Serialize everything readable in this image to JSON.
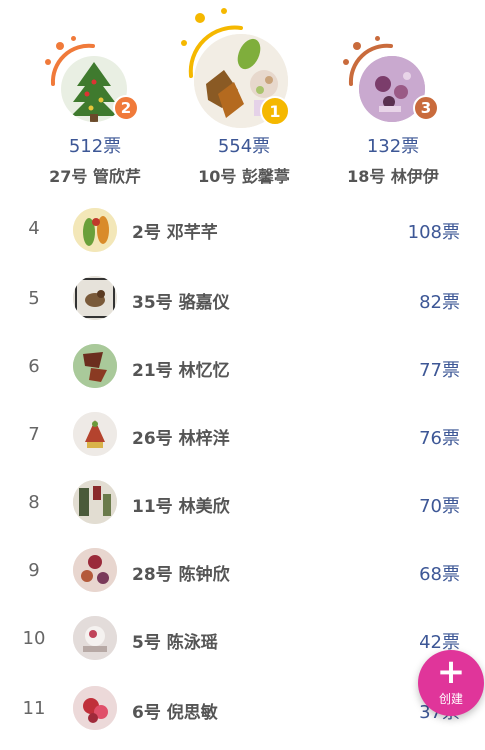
{
  "podium": [
    {
      "rank": "2",
      "votes": "512票",
      "name": "27号 管欣芹",
      "badge_color": "#f07a3a",
      "arc_color": "#f07a3a",
      "avatar_theme": "christmas-tree-art",
      "avatar_bg": "#e9efe3"
    },
    {
      "rank": "1",
      "votes": "554票",
      "name": "10号 彭馨葶",
      "badge_color": "#f5b800",
      "arc_color": "#f5b800",
      "avatar_theme": "leaf-collage-art",
      "avatar_bg": "#f2ede4"
    },
    {
      "rank": "3",
      "votes": "132票",
      "name": "18号 林伊伊",
      "badge_color": "#c96b3c",
      "arc_color": "#c96b3c",
      "avatar_theme": "flower-art-purple",
      "avatar_bg": "#c9a9cf"
    }
  ],
  "list": [
    {
      "rank": "4",
      "name": "2号 邓芊芊",
      "votes": "108票",
      "avatar_color": "#f3e7b8"
    },
    {
      "rank": "5",
      "name": "35号 骆嘉仪",
      "votes": "82票",
      "avatar_color": "#e6e2da"
    },
    {
      "rank": "6",
      "name": "21号 林忆忆",
      "votes": "77票",
      "avatar_color": "#a9c99a"
    },
    {
      "rank": "7",
      "name": "26号 林梓洋",
      "votes": "76票",
      "avatar_color": "#eeeae6"
    },
    {
      "rank": "8",
      "name": "11号 林美欣",
      "votes": "70票",
      "avatar_color": "#e2ddd2"
    },
    {
      "rank": "9",
      "name": "28号 陈钟欣",
      "votes": "68票",
      "avatar_color": "#e8d6cf"
    },
    {
      "rank": "10",
      "name": "5号 陈泳瑶",
      "votes": "42票",
      "avatar_color": "#e3dcda"
    },
    {
      "rank": "11",
      "name": "6号 倪思敏",
      "votes": "37票",
      "avatar_color": "#ecd9d9"
    }
  ],
  "fab": {
    "icon": "plus-icon",
    "label": "创建",
    "color": "#e0359a"
  }
}
